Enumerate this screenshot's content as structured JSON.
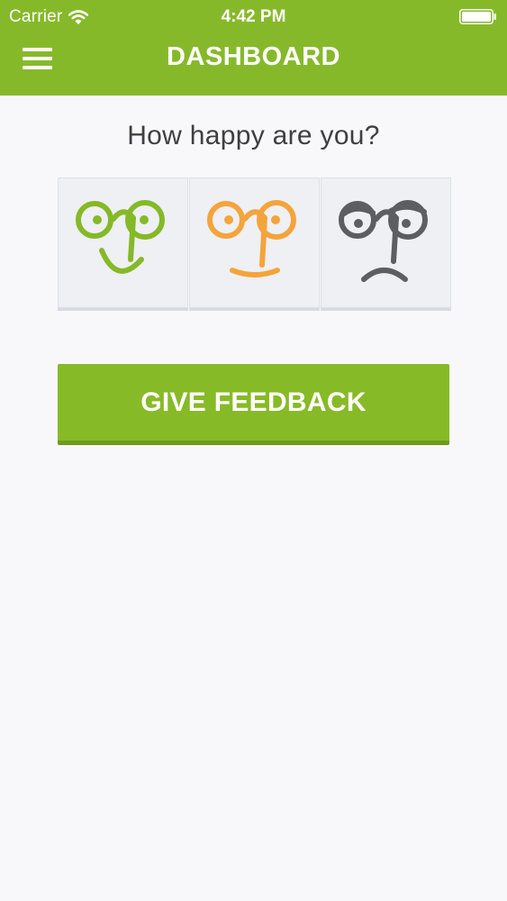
{
  "status_bar": {
    "carrier": "Carrier",
    "time": "4:42 PM",
    "wifi_icon": "wifi-icon",
    "battery_icon": "battery-icon"
  },
  "header": {
    "title": "DASHBOARD",
    "menu_icon": "hamburger-menu-icon",
    "background_color": "#86b92a"
  },
  "question": "How happy are you?",
  "moods": [
    {
      "name": "happy",
      "icon": "happy-face-icon",
      "color": "#85b927"
    },
    {
      "name": "neutral",
      "icon": "neutral-face-icon",
      "color": "#f4a43c"
    },
    {
      "name": "sad",
      "icon": "sad-face-icon",
      "color": "#5c5e61"
    }
  ],
  "feedback_button": {
    "label": "GIVE FEEDBACK",
    "color": "#87ba27"
  }
}
